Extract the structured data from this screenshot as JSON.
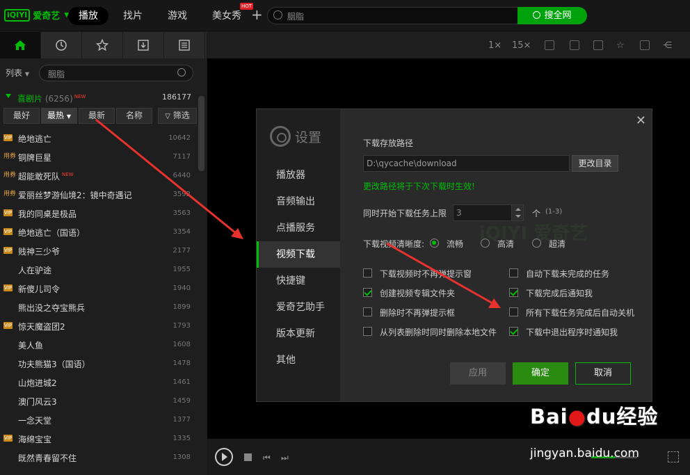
{
  "app": {
    "logo_mark": "iQIYI",
    "logo_text": "爱奇艺"
  },
  "nav": {
    "tabs": [
      "播放",
      "找片",
      "游戏",
      "美女秀"
    ],
    "hot_badge": "HOT",
    "plus": "+"
  },
  "search": {
    "query": "胭脂",
    "button": "搜全网"
  },
  "sidebar": {
    "list_label": "列表",
    "search_query": "胭脂",
    "category": {
      "name": "喜剧片",
      "count": "(6256)",
      "new_badge": "NEW",
      "total": "186177"
    },
    "sort_buttons": [
      "最好",
      "最热",
      "最新",
      "名称"
    ],
    "filter_button": "筛选",
    "rows": [
      {
        "badge": "VIP",
        "title": "绝地逃亡",
        "num": "10642"
      },
      {
        "badge": "用券",
        "title": "铜牌巨星",
        "num": "7117"
      },
      {
        "badge": "用券",
        "title": "超能敢死队",
        "num": "6440",
        "new": "NEW"
      },
      {
        "badge": "用券",
        "title": "爱丽丝梦游仙境2：镜中奇遇记",
        "num": "3592"
      },
      {
        "badge": "VIP",
        "title": "我的同桌是极品",
        "num": "3563"
      },
      {
        "badge": "VIP",
        "title": "绝地逃亡（国语）",
        "num": "3354"
      },
      {
        "badge": "VIP",
        "title": "贱神三少爷",
        "num": "2177"
      },
      {
        "badge": "",
        "title": "人在驴途",
        "num": "1955"
      },
      {
        "badge": "VIP",
        "title": "新傻儿司令",
        "num": "1940"
      },
      {
        "badge": "",
        "title": "熊出没之夺宝熊兵",
        "num": "1899"
      },
      {
        "badge": "VIP",
        "title": "惊天魔盗团2",
        "num": "1793"
      },
      {
        "badge": "",
        "title": "美人鱼",
        "num": "1608"
      },
      {
        "badge": "",
        "title": "功夫熊猫3（国语）",
        "num": "1478"
      },
      {
        "badge": "",
        "title": "山炮进城2",
        "num": "1461"
      },
      {
        "badge": "",
        "title": "澳门风云3",
        "num": "1459"
      },
      {
        "badge": "",
        "title": "一念天堂",
        "num": "1377"
      },
      {
        "badge": "VIP",
        "title": "海绵宝宝",
        "num": "1335"
      },
      {
        "badge": "",
        "title": "既然青春留不住",
        "num": "1308"
      }
    ]
  },
  "toolbar": {
    "speed1": "1×",
    "speed15": "15×"
  },
  "dialog": {
    "title": "设置",
    "nav": [
      "播放器",
      "音频输出",
      "点播服务",
      "视频下载",
      "快捷键",
      "爱奇艺助手",
      "版本更新",
      "其他"
    ],
    "active_index": 3,
    "path_label": "下载存放路径",
    "path_value": "D:\\qycache\\download",
    "change_dir": "更改目录",
    "path_tip": "更改路径将于下次下载时生效!",
    "limit_label": "同时开始下载任务上限",
    "limit_value": "3",
    "limit_unit": "个",
    "limit_range": "(1-3)",
    "quality_label": "下载视频清晰度:",
    "quality_options": [
      "流畅",
      "高清",
      "超清"
    ],
    "checkboxes": [
      {
        "label": "下载视频时不再弹提示窗",
        "checked": false
      },
      {
        "label": "自动下载未完成的任务",
        "checked": false
      },
      {
        "label": "创建视频专辑文件夹",
        "checked": true
      },
      {
        "label": "下载完成后通知我",
        "checked": true
      },
      {
        "label": "删除时不再弹提示框",
        "checked": false
      },
      {
        "label": "所有下载任务完成后自动关机",
        "checked": false
      },
      {
        "label": "从列表删除时同时删除本地文件",
        "checked": false
      },
      {
        "label": "下载中退出程序时通知我",
        "checked": true
      }
    ],
    "btn_apply": "应用",
    "btn_ok": "确定",
    "btn_cancel": "取消",
    "close": "✕"
  },
  "watermark": {
    "brand": "Bai",
    "paw": "du",
    "suffix": "经验",
    "url": "jingyan.baidu.com"
  },
  "colors": {
    "accent": "#00be06",
    "arrow": "#e8322e"
  },
  "player": {
    "volume_level": 0.52
  }
}
